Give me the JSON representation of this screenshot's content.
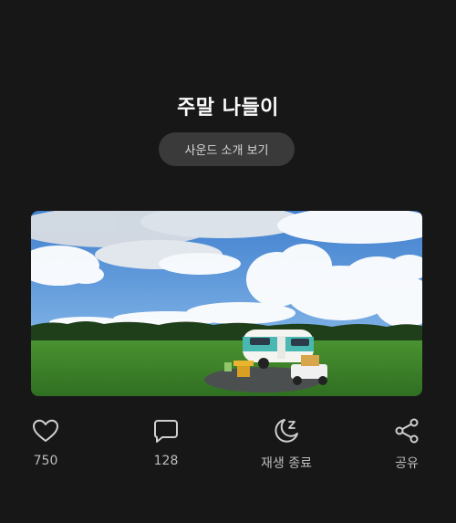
{
  "post": {
    "title": "주말 나들이",
    "sound_button_label": "사운드 소개 보기"
  },
  "photo": {
    "description_icon": "photo",
    "sky_color": "#4f8fd6",
    "grass_color": "#3f8a2a"
  },
  "actions": {
    "like": {
      "icon": "heart-icon",
      "label": "750"
    },
    "comment": {
      "icon": "comment-icon",
      "label": "128"
    },
    "sleep": {
      "icon": "moon-zz-icon",
      "label": "재생 종료"
    },
    "share": {
      "icon": "share-icon",
      "label": "공유"
    }
  }
}
